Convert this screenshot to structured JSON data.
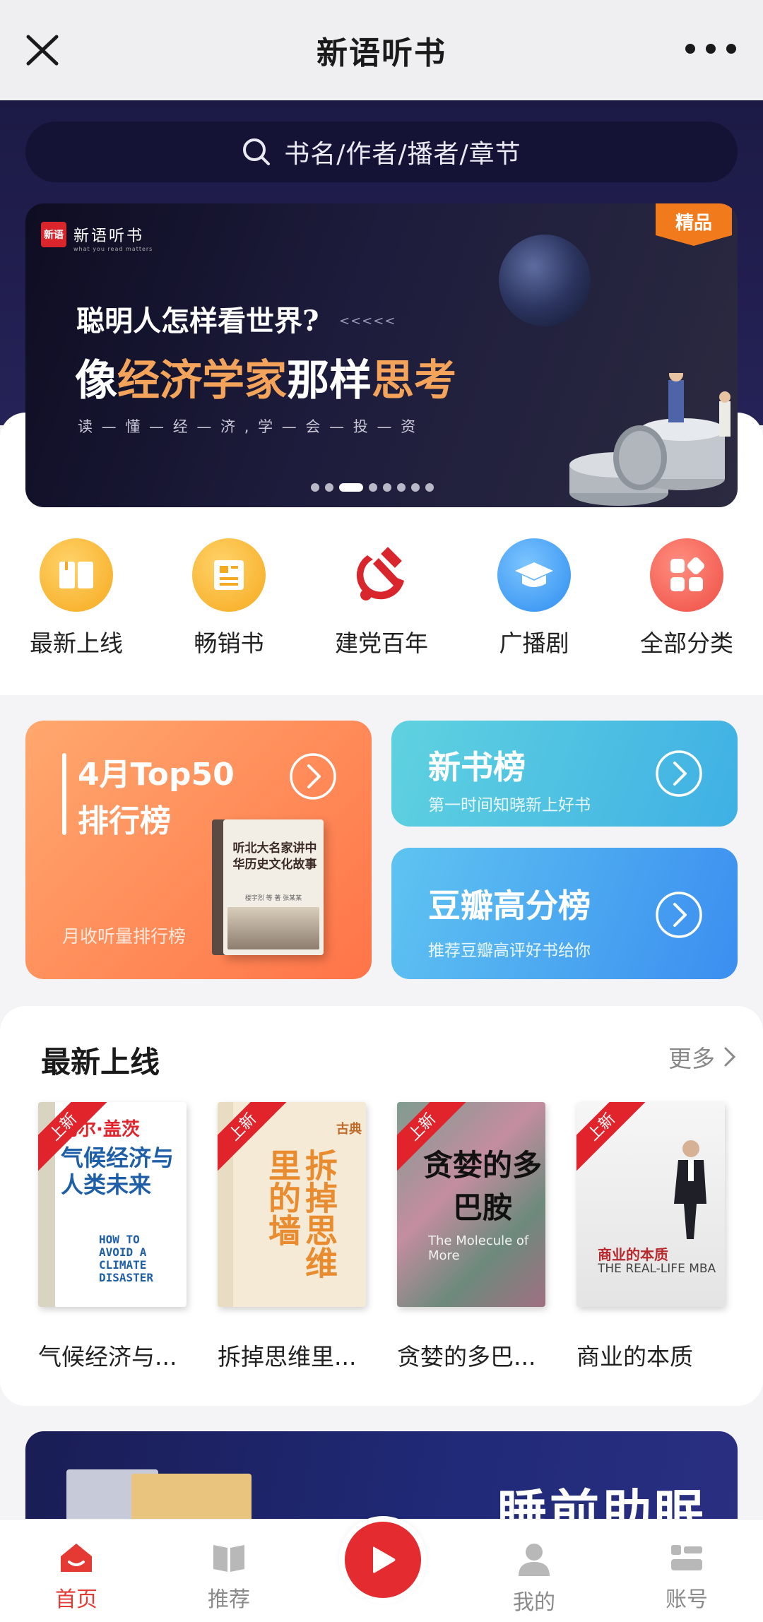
{
  "titlebar": {
    "title": "新语听书"
  },
  "search": {
    "placeholder": "书名/作者/播者/章节"
  },
  "banner": {
    "brand": "新语听书",
    "brand_logo": "新语",
    "brand_sub": "what you read matters",
    "tag": "精品",
    "line1": "聪明人怎样看世界?",
    "line1_arrows": "<<<<<",
    "line2_a": "像",
    "line2_b": "经济学家",
    "line2_c": "那样",
    "line2_d": "思考",
    "line3": "读 — 懂 — 经 — 济 , 学 — 会 — 投 — 资",
    "slide_count": 8,
    "active_slide": 3
  },
  "categories": [
    {
      "label": "最新上线",
      "icon": "book-open-icon",
      "color": "#f9b52a"
    },
    {
      "label": "畅销书",
      "icon": "newspaper-icon",
      "color": "#f9b52a"
    },
    {
      "label": "建党百年",
      "icon": "hammer-sickle-icon",
      "color": "#d8262c"
    },
    {
      "label": "广播剧",
      "icon": "graduation-cap-icon",
      "color": "#3a9bf1"
    },
    {
      "label": "全部分类",
      "icon": "grid-icon",
      "color": "#f25b4f"
    }
  ],
  "rank": {
    "top50_title1": "4月Top50",
    "top50_title2": "排行榜",
    "top50_sub": "月收听量排行榜",
    "top50_book_title": "听北大名家讲中华历史文化故事",
    "top50_book_author": "楼宇烈 等  著  张某某",
    "new_title": "新书榜",
    "new_sub": "第一时间知晓新上好书",
    "douban_title": "豆瓣高分榜",
    "douban_sub": "推荐豆瓣高评好书给你"
  },
  "newest": {
    "heading": "最新上线",
    "more": "更多",
    "ribbon": "上新",
    "books": [
      {
        "name": "气候经济与...",
        "cover_title": "气候经济与人类未来",
        "cover_author": "比尔·盖茨",
        "cover_en": "HOW TO AVOID A CLIMATE DISASTER"
      },
      {
        "name": "拆掉思维里...",
        "cover_title": "拆掉思维里的墙",
        "cover_author": "古典"
      },
      {
        "name": "贪婪的多巴...",
        "cover_title": "贪婪的多巴胺",
        "cover_en": "The Molecule of More"
      },
      {
        "name": "商业的本质",
        "cover_title": "商业的本质",
        "cover_en": "THE REAL-LIFE MBA"
      }
    ]
  },
  "bottom_banner": {
    "title": "睡前助眠"
  },
  "nav": {
    "items": [
      {
        "label": "首页",
        "icon": "home-icon",
        "active": true
      },
      {
        "label": "推荐",
        "icon": "book-icon",
        "active": false
      },
      {
        "label": "我的",
        "icon": "user-icon",
        "active": false
      },
      {
        "label": "账号",
        "icon": "account-icon",
        "active": false
      }
    ]
  },
  "colors": {
    "accent": "#e42b2f",
    "header": "#1c1a45",
    "orange": "#ff7448",
    "blue": "#3b8ef0"
  }
}
